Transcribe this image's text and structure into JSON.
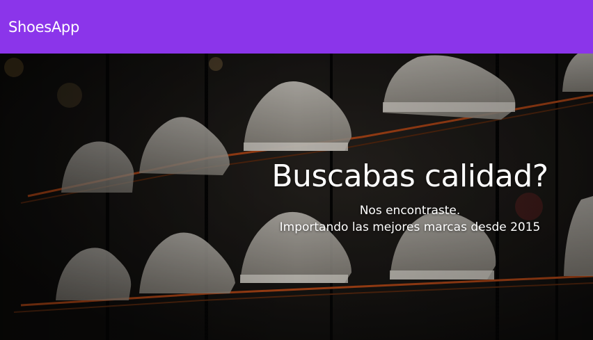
{
  "navbar": {
    "brand": "ShoesApp",
    "background": "#8b35ea"
  },
  "hero": {
    "headline": "Buscabas calidad?",
    "subtitle_line1": "Nos encontraste.",
    "subtitle_line2": "Importando las mejores marcas desde 2015",
    "image_subject": "white sneakers on illuminated store shelves"
  }
}
